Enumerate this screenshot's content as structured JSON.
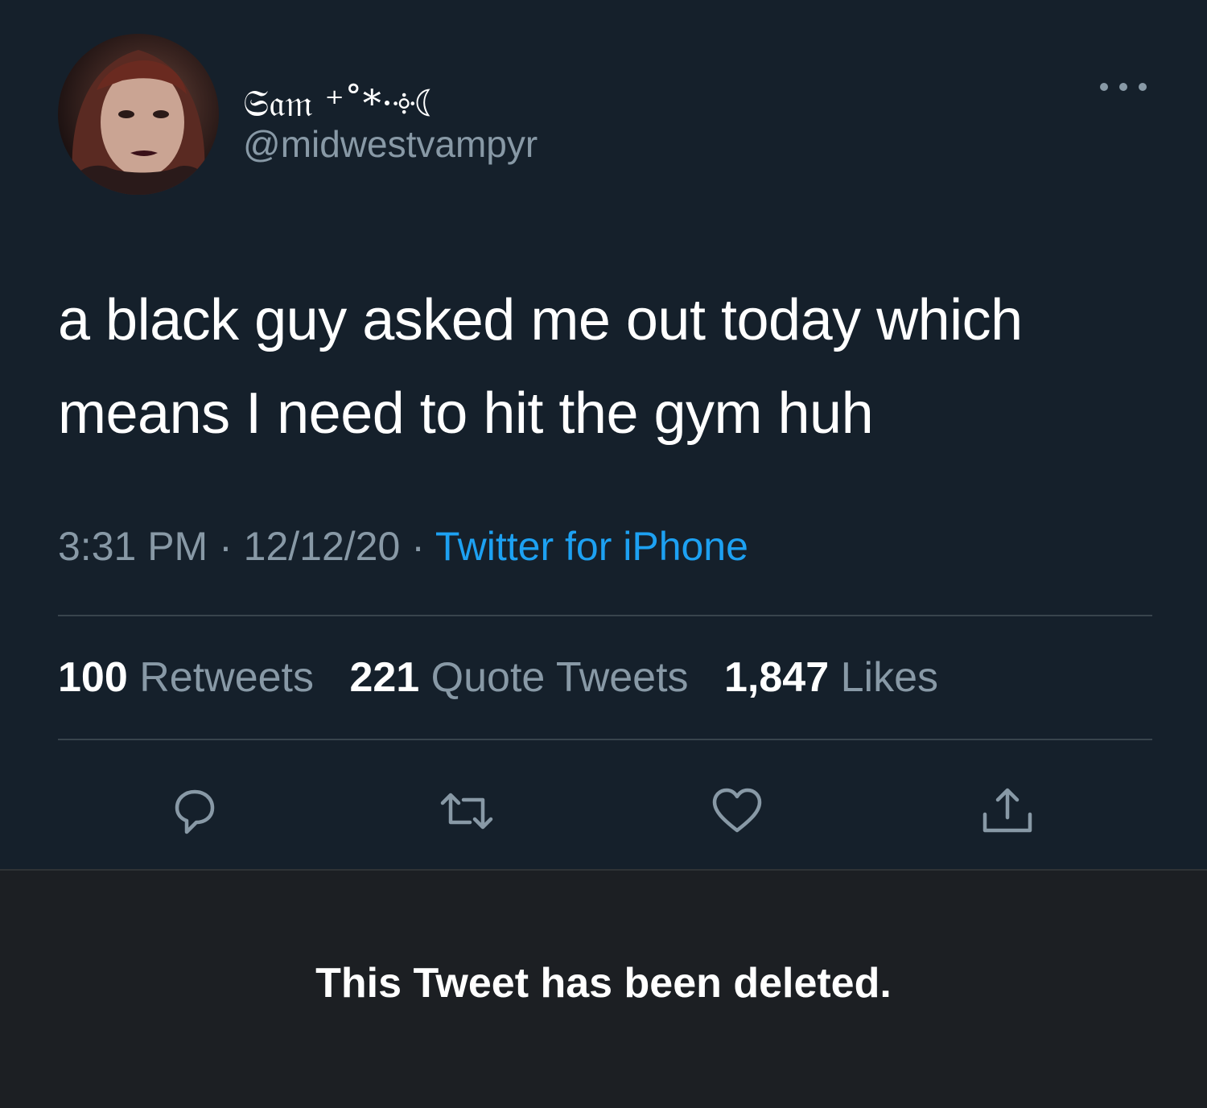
{
  "tweet": {
    "display_name": "𝔖𝔞𝔪 ⁺˚*·༓☾",
    "handle": "@midwestvampyr",
    "text": "a black guy asked me out today which means I need to hit the gym huh",
    "time": "3:31 PM",
    "date": "12/12/20",
    "source": "Twitter for iPhone",
    "stats": {
      "retweets_count": "100",
      "retweets_label": "Retweets",
      "quotes_count": "221",
      "quotes_label": "Quote Tweets",
      "likes_count": "1,847",
      "likes_label": "Likes"
    },
    "icons": {
      "more": "more-options-icon",
      "reply": "reply-icon",
      "retweet": "retweet-icon",
      "like": "like-icon",
      "share": "share-icon"
    }
  },
  "deleted_notice": {
    "text": "This Tweet has been deleted."
  },
  "colors": {
    "background": "#15202b",
    "secondary_text": "#8899a6",
    "accent": "#1da1f2",
    "divider": "#38444d",
    "deleted_background": "#1c1f23"
  }
}
